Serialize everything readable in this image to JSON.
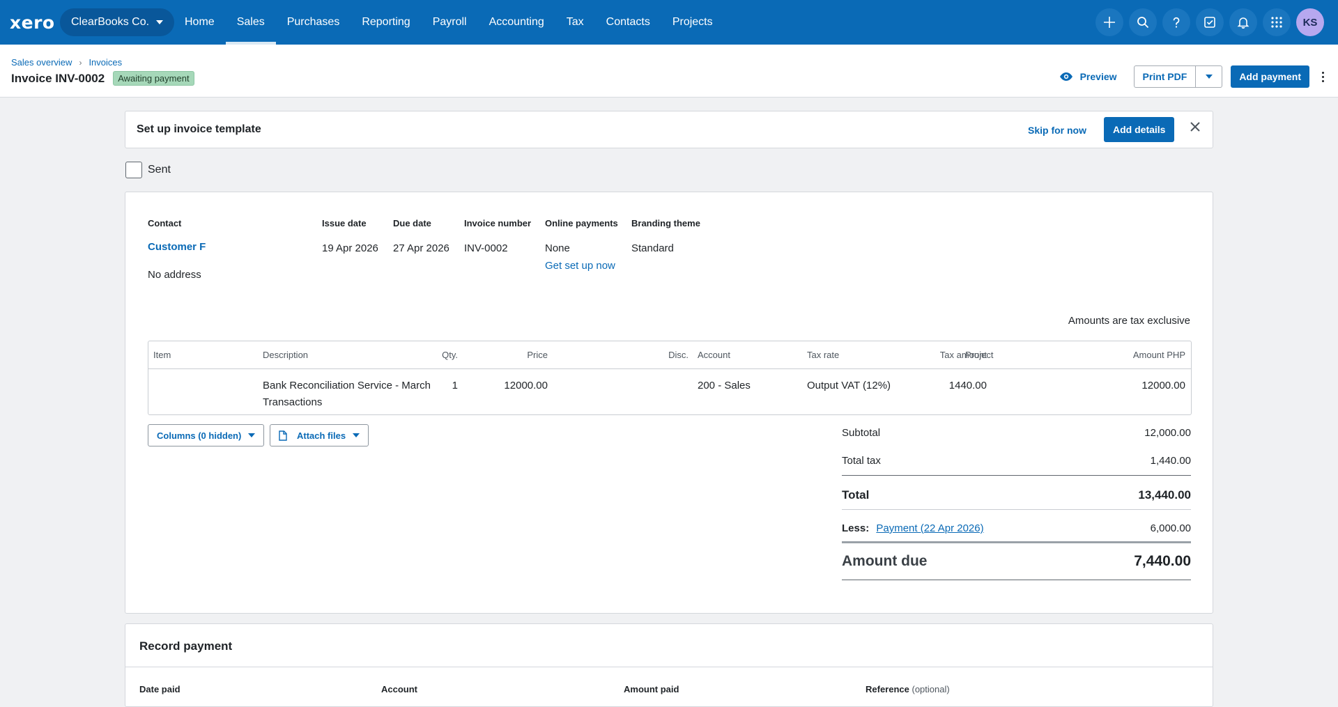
{
  "nav": {
    "logo": "xero",
    "org": "ClearBooks Co.",
    "items": [
      "Home",
      "Sales",
      "Purchases",
      "Reporting",
      "Payroll",
      "Accounting",
      "Tax",
      "Contacts",
      "Projects"
    ],
    "active": "Sales",
    "icons": [
      "plus-icon",
      "search-icon",
      "help-icon",
      "tasks-icon",
      "bell-icon",
      "apps-grid-icon"
    ],
    "avatar": "KS"
  },
  "header": {
    "breadcrumbs": [
      "Sales overview",
      "Invoices"
    ],
    "title": "Invoice INV-0002",
    "status": "Awaiting payment",
    "preview": "Preview",
    "print_pdf": "Print PDF",
    "add_payment": "Add payment"
  },
  "banner": {
    "title": "Set up invoice template",
    "skip": "Skip for now",
    "add_details": "Add details"
  },
  "sent_label": "Sent",
  "invoice": {
    "labels": {
      "contact": "Contact",
      "issue_date": "Issue date",
      "due_date": "Due date",
      "invoice_number": "Invoice number",
      "online_payments": "Online payments",
      "branding_theme": "Branding theme"
    },
    "contact": "Customer F",
    "address": "No address",
    "issue_date": "19 Apr 2026",
    "due_date": "27 Apr 2026",
    "invoice_number": "INV-0002",
    "online_payments": "None",
    "get_set_up": "Get set up now",
    "branding_theme": "Standard",
    "tax_note": "Amounts are tax exclusive",
    "columns": [
      "Item",
      "Description",
      "Qty.",
      "Price",
      "Disc.",
      "Account",
      "Tax rate",
      "Tax amount",
      "Project",
      "Amount PHP"
    ],
    "line": {
      "item": "",
      "description_1": "Bank Reconciliation Service -  March",
      "description_2": "Transactions",
      "qty": "1",
      "price": "12000.00",
      "disc": "",
      "account": "200 - Sales",
      "tax_rate": "Output VAT (12%)",
      "tax_amount": "1440.00",
      "project": "",
      "amount": "12000.00"
    },
    "columns_btn": "Columns (0 hidden)",
    "attach_btn": "Attach files",
    "totals": {
      "subtotal_label": "Subtotal",
      "subtotal": "12,000.00",
      "tax_label": "Total tax",
      "tax": "1,440.00",
      "total_label": "Total",
      "total": "13,440.00",
      "less_label": "Less:",
      "payment_link": "Payment (22 Apr 2026)",
      "payment": "6,000.00",
      "due_label": "Amount due",
      "due": "7,440.00"
    }
  },
  "record_payment": {
    "title": "Record payment",
    "date_paid": "Date paid",
    "account": "Account",
    "amount_paid": "Amount paid",
    "reference": "Reference",
    "optional": "(optional)"
  }
}
